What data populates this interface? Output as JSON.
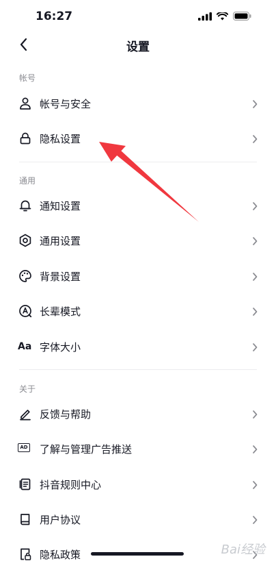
{
  "status": {
    "time": "16:27"
  },
  "nav": {
    "title": "设置"
  },
  "sections": {
    "account": "帐号",
    "general": "通用",
    "about": "关于"
  },
  "rows": {
    "account_security": "帐号与安全",
    "privacy_settings": "隐私设置",
    "notification_settings": "通知设置",
    "general_settings": "通用设置",
    "background_settings": "背景设置",
    "elder_mode": "长辈模式",
    "font_size": "字体大小",
    "font_size_icon_text": "Aa",
    "feedback_help": "反馈与帮助",
    "ad_management": "了解与管理广告推送",
    "ad_icon_text": "AD",
    "rules_center": "抖音规则中心",
    "user_agreement": "用户协议",
    "privacy_policy": "隐私政策"
  },
  "watermark": "Bai经验",
  "colors": {
    "text": "#161823",
    "section": "#8a8b91",
    "annotation_arrow": "#f0383f"
  }
}
